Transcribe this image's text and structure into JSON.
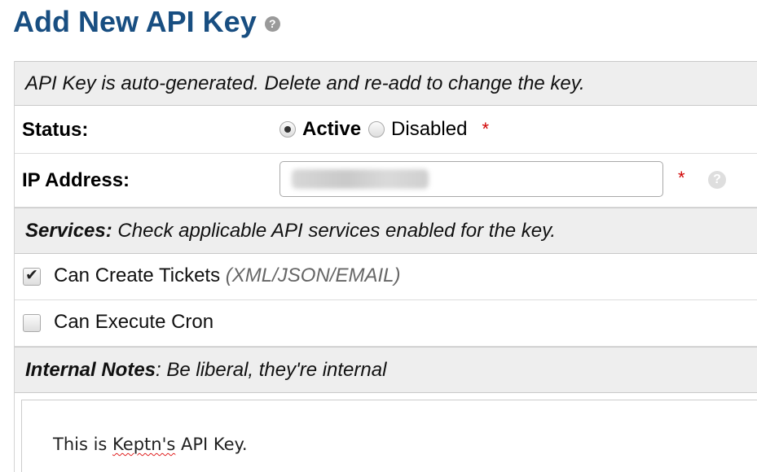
{
  "page": {
    "title": "Add New API Key",
    "title_color": "#184E81"
  },
  "info_banner": {
    "text": "API Key is auto-generated. Delete and re-add to change the key."
  },
  "status": {
    "label": "Status:",
    "options": [
      {
        "label": "Active",
        "selected": true
      },
      {
        "label": "Disabled",
        "selected": false
      }
    ],
    "required_marker": "*"
  },
  "ip_address": {
    "label": "IP Address:",
    "value": "",
    "value_obscured": true,
    "required_marker": "*"
  },
  "services": {
    "heading": "Services:",
    "description": " Check applicable API services enabled for the key.",
    "items": [
      {
        "label": "Can Create Tickets",
        "note": "(XML/JSON/EMAIL)",
        "checked": true
      },
      {
        "label": "Can Execute Cron",
        "note": "",
        "checked": false
      }
    ]
  },
  "internal_notes": {
    "heading": "Internal Notes",
    "description": ": Be liberal, they're internal",
    "content_before": "This is ",
    "content_misspelled": "Keptn's",
    "content_after": " API Key."
  },
  "icons": {
    "help": "question-circle-icon",
    "check": "checkmark-icon"
  }
}
